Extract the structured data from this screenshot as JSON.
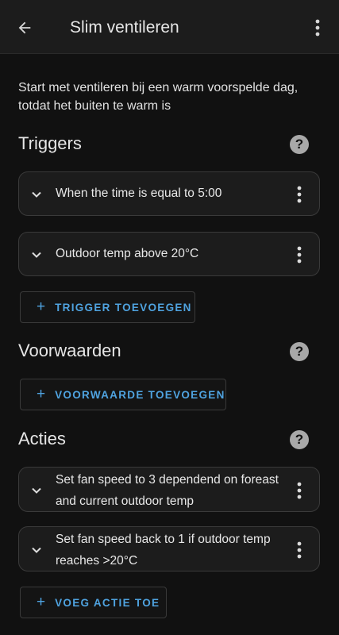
{
  "appbar": {
    "title": "Slim ventileren",
    "back_icon": "arrow-left-icon",
    "menu_icon": "more-vertical-icon"
  },
  "description": "Start met ventileren bij een warm voorspelde dag, totdat het buiten te warm is",
  "triggers": {
    "title": "Triggers",
    "items": [
      {
        "label": "When the time is equal to 5:00"
      },
      {
        "label": "Outdoor temp above 20°C"
      }
    ],
    "add_label": "TRIGGER TOEVOEGEN"
  },
  "conditions": {
    "title": "Voorwaarden",
    "add_label": "VOORWAARDE TOEVOEGEN"
  },
  "actions": {
    "title": "Acties",
    "items": [
      {
        "label": "Set fan speed to 3 dependend on foreast and current outdoor temp"
      },
      {
        "label": "Set fan speed back to 1 if outdoor temp reaches >20°C"
      }
    ],
    "add_label": "VOEG ACTIE TOE"
  },
  "colors": {
    "accent": "#4fa3e0",
    "background": "#111111",
    "card": "#1c1c1c"
  }
}
